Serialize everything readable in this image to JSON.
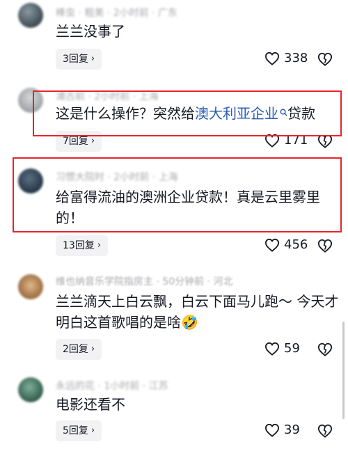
{
  "comments": [
    {
      "meta": "棒虫 · 粗美 · 2小时前 · 广东",
      "text": "兰兰没事了",
      "replies": "3回复",
      "likes": "338"
    },
    {
      "meta": "浦古前 · 2小时前 · 上海",
      "text_before": "这是什么操作？突然给",
      "text_link": "澳大利亚企业",
      "text_after": "贷款",
      "replies": "7回复",
      "likes": "171"
    },
    {
      "meta": "习惯大院时 · 2小时前 · 上海",
      "text": "给富得流油的澳洲企业贷款！真是云里雾里的！",
      "replies": "13回复",
      "likes": "456"
    },
    {
      "meta": "维也纳音乐学院指房主 · 50分钟前 · 河北",
      "text": "兰兰滴天上白云飘，白云下面马儿跑～ 今天才明白这首歌唱的是啥🤣",
      "replies": "2回复",
      "likes": "59"
    },
    {
      "meta": "永远的花 · 1小时前 · 江苏",
      "text": "电影还看不",
      "replies": "5回复",
      "likes": "39"
    }
  ],
  "icons": {
    "like": "heart-outline-icon",
    "dislike": "broken-heart-icon",
    "reply_chevron": "chevron-right-icon",
    "search": "search-icon"
  },
  "colors": {
    "highlight_box": "#e8222c",
    "link": "#2a5db0",
    "meta_text": "#a9a9ae",
    "reply_bg": "#f2f2f4"
  }
}
